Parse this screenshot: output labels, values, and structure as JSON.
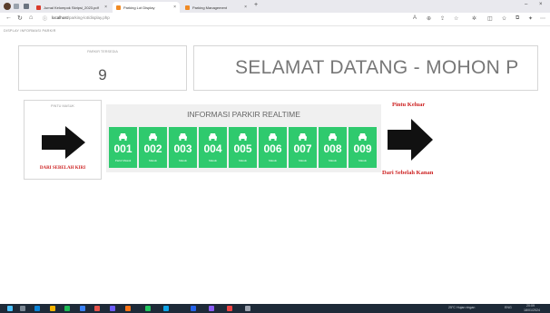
{
  "browser": {
    "tabs": [
      {
        "label": "Jurnal Kelompok Skripsi_2023.pdf",
        "favicon_color": "#d93a2b",
        "active": false
      },
      {
        "label": "Parking Lot Display",
        "favicon_color": "#f08a24",
        "active": true
      },
      {
        "label": "Parking Management",
        "favicon_color": "#f08a24",
        "active": false
      }
    ],
    "new_tab": "+",
    "url_host": "localhost",
    "url_path": "/parking-lot/display.php",
    "window_controls": [
      "–",
      "×"
    ]
  },
  "breadcrumb": "DISPLAY INFORMASI PARKIR",
  "available": {
    "label": "PARKIR TERSEDIA",
    "count": "9"
  },
  "welcome": {
    "text": "SELAMAT DATANG - MOHON P"
  },
  "entry": {
    "label": "PINTU MASUK",
    "direction": "DARI SEBELAH KIRI",
    "arrow_color": "#111111"
  },
  "realtime": {
    "title": "INFORMASI PARKIR REALTIME",
    "slot_color": "#2fca6e",
    "slots": [
      {
        "id": "001",
        "status": "Parkir Masuk"
      },
      {
        "id": "002",
        "status": "Masuk"
      },
      {
        "id": "003",
        "status": "Masuk"
      },
      {
        "id": "004",
        "status": "Masuk"
      },
      {
        "id": "005",
        "status": "Masuk"
      },
      {
        "id": "006",
        "status": "Masuk"
      },
      {
        "id": "007",
        "status": "Masuk"
      },
      {
        "id": "008",
        "status": "Masuk"
      },
      {
        "id": "009",
        "status": "Masuk"
      }
    ]
  },
  "exit": {
    "label": "Pintu Keluar",
    "direction": "Dari Sebelah Kanan",
    "text_color": "#cc1f1f"
  },
  "taskbar": {
    "weather": "25°C Hujan ringan",
    "time": "20:09",
    "date": "18/01/2024",
    "lang": "ENG"
  }
}
